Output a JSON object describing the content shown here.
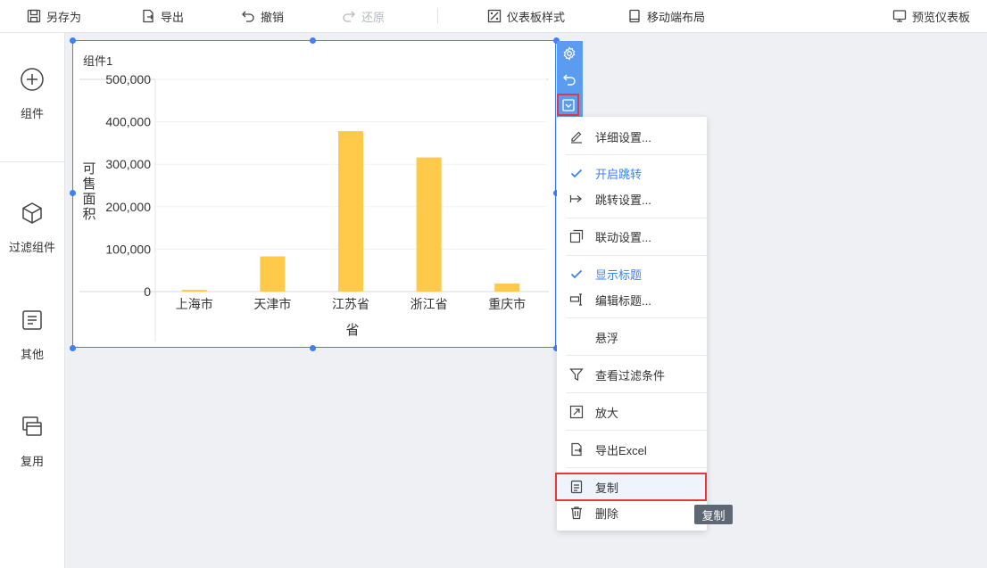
{
  "toolbar": {
    "save_as": "另存为",
    "export": "导出",
    "undo": "撤销",
    "redo": "还原",
    "dashboard_style": "仪表板样式",
    "mobile_layout": "移动端布局",
    "preview": "预览仪表板"
  },
  "sidebar": {
    "items": [
      {
        "label": "组件",
        "icon": "plus-circle-icon"
      },
      {
        "label": "过滤组件",
        "icon": "cube-icon"
      },
      {
        "label": "其他",
        "icon": "document-icon"
      },
      {
        "label": "复用",
        "icon": "reuse-icon"
      }
    ]
  },
  "widget": {
    "title": "组件1"
  },
  "chart_data": {
    "type": "bar",
    "categories": [
      "上海市",
      "天津市",
      "江苏省",
      "浙江省",
      "重庆市"
    ],
    "values": [
      4000,
      83000,
      378000,
      316000,
      19000
    ],
    "xlabel": "省",
    "ylabel": "可售面积",
    "yticks": [
      "0",
      "100,000",
      "200,000",
      "300,000",
      "400,000",
      "500,000"
    ],
    "ylim": [
      0,
      500000
    ],
    "bar_color": "#ffc94a"
  },
  "menu": {
    "items": [
      {
        "label": "详细设置...",
        "icon": "edit-icon"
      },
      {
        "label": "开启跳转",
        "icon": "check-icon",
        "checked": true
      },
      {
        "label": "跳转设置...",
        "icon": "jump-icon"
      },
      {
        "label": "联动设置...",
        "icon": "link-icon"
      },
      {
        "label": "显示标题",
        "icon": "check-icon",
        "checked": true
      },
      {
        "label": "编辑标题...",
        "icon": "edit-title-icon"
      },
      {
        "label": "悬浮",
        "icon": ""
      },
      {
        "label": "查看过滤条件",
        "icon": "filter-icon"
      },
      {
        "label": "放大",
        "icon": "zoom-icon"
      },
      {
        "label": "导出Excel",
        "icon": "export-icon"
      },
      {
        "label": "复制",
        "icon": "copy-icon"
      },
      {
        "label": "删除",
        "icon": "delete-icon"
      }
    ]
  },
  "tooltip": "复制",
  "colors": {
    "accent": "#3b82f6",
    "highlight_border": "#e0393e"
  }
}
